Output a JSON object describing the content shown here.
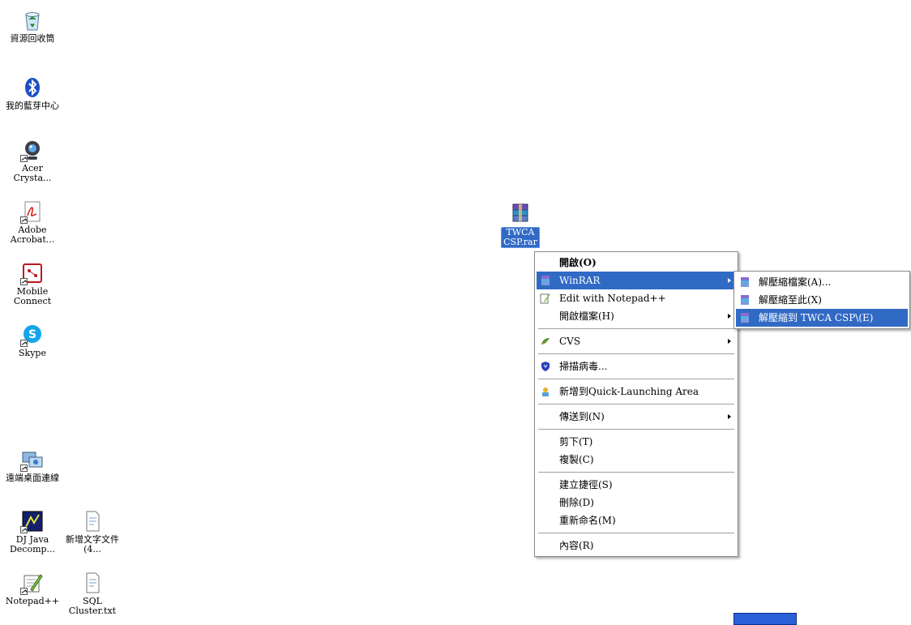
{
  "desktop": {
    "icons": [
      {
        "label": "資源回收筒"
      },
      {
        "label": "我的藍芽中心"
      },
      {
        "label": "Acer Crysta..."
      },
      {
        "label": "Adobe Acrobat..."
      },
      {
        "label": "Mobile Connect"
      },
      {
        "label": "Skype"
      },
      {
        "label": "遠端桌面連線"
      },
      {
        "label": "DJ Java Decomp..."
      },
      {
        "label": "新增文字文件 (4..."
      },
      {
        "label": "Notepad++"
      },
      {
        "label": "SQL Cluster.txt"
      }
    ],
    "selected_file": {
      "line1": "TWCA",
      "line2": "CSP.rar"
    }
  },
  "context_menu": {
    "open": "開啟(O)",
    "winrar": "WinRAR",
    "edit_notepad": "Edit with Notepad++",
    "open_with": "開啟檔案(H)",
    "cvs": "CVS",
    "scan_virus": "掃描病毒...",
    "add_quick_launch": "新增到Quick-Launching Area",
    "send_to": "傳送到(N)",
    "cut": "剪下(T)",
    "copy": "複製(C)",
    "create_shortcut": "建立捷徑(S)",
    "delete": "刪除(D)",
    "rename": "重新命名(M)",
    "properties": "內容(R)"
  },
  "winrar_submenu": {
    "extract_files": "解壓縮檔案(A)...",
    "extract_here": "解壓縮至此(X)",
    "extract_to": "解壓縮到 TWCA CSP\\(E)"
  },
  "colors": {
    "highlight": "#316ac5",
    "menu_border": "#8a8a8a"
  }
}
